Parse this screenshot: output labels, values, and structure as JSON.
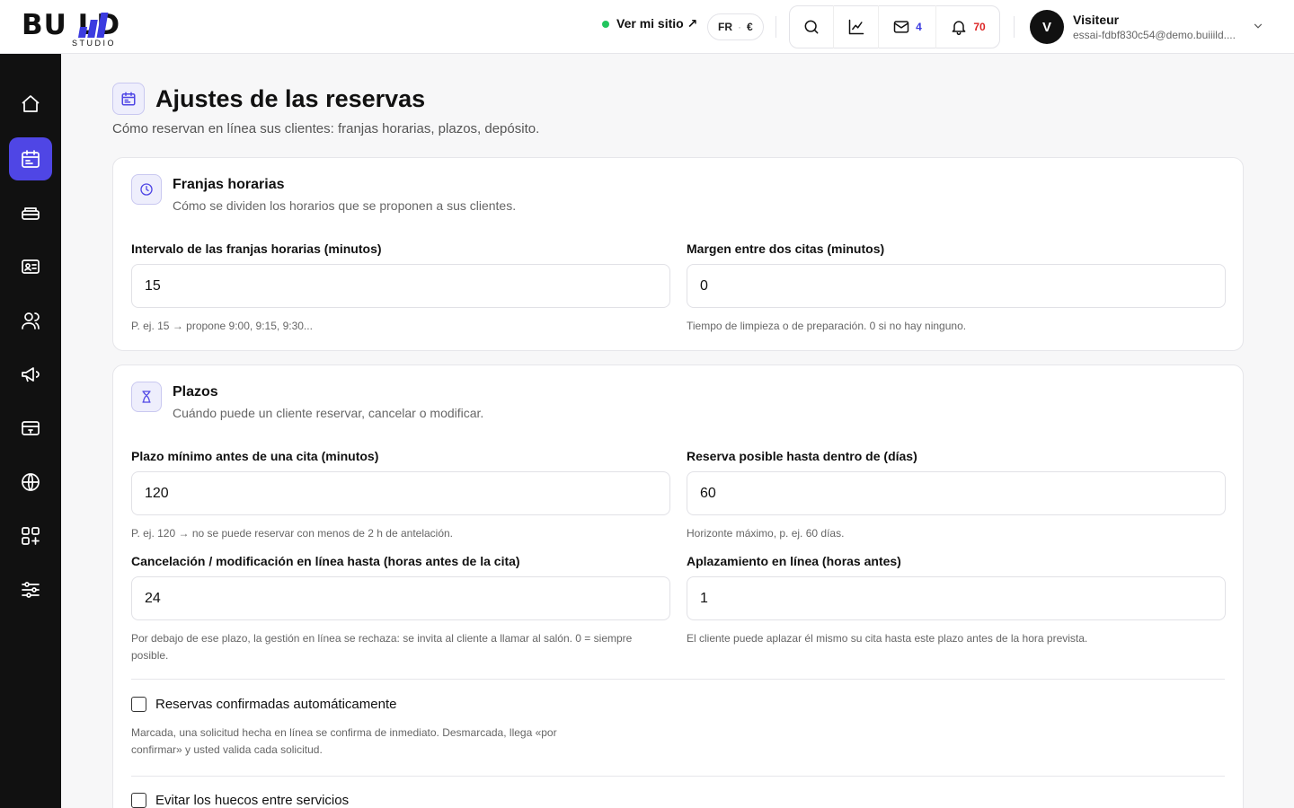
{
  "brand": {
    "logo_text": "BU  LD",
    "logo_sub": "STUDIO",
    "accent": "#4f46e5"
  },
  "header": {
    "site_link": "Ver mi sitio ↗",
    "lang": "FR",
    "currency": "€",
    "messages_count": "4",
    "notifications_count": "70",
    "user": {
      "initial": "V",
      "name": "Visiteur",
      "email": "essai-fdbf830c54@demo.buiiild...."
    }
  },
  "sidebar": {
    "items": [
      {
        "name": "home",
        "icon": "home-icon"
      },
      {
        "name": "calendar",
        "icon": "calendar-icon",
        "active": true
      },
      {
        "name": "services",
        "icon": "stack-icon"
      },
      {
        "name": "contacts",
        "icon": "id-card-icon"
      },
      {
        "name": "clients",
        "icon": "users-icon"
      },
      {
        "name": "marketing",
        "icon": "megaphone-icon"
      },
      {
        "name": "payments",
        "icon": "card-icon"
      },
      {
        "name": "website",
        "icon": "globe-icon"
      },
      {
        "name": "apps",
        "icon": "apps-add-icon"
      },
      {
        "name": "settings",
        "icon": "sliders-icon"
      }
    ]
  },
  "page": {
    "title": "Ajustes de las reservas",
    "subtitle": "Cómo reservan en línea sus clientes: franjas horarias, plazos, depósito."
  },
  "slots": {
    "title": "Franjas horarias",
    "desc": "Cómo se dividen los horarios que se proponen a sus clientes.",
    "interval_label": "Intervalo de las franjas horarias (minutos)",
    "interval_value": "15",
    "interval_hint": "P. ej. 15 → propone 9:00, 9:15, 9:30...",
    "margin_label": "Margen entre dos citas (minutos)",
    "margin_value": "0",
    "margin_hint": "Tiempo de limpieza o de preparación. 0 si no hay ninguno."
  },
  "deadlines": {
    "title": "Plazos",
    "desc": "Cuándo puede un cliente reservar, cancelar o modificar.",
    "min_label": "Plazo mínimo antes de una cita (minutos)",
    "min_value": "120",
    "min_hint": "P. ej. 120 → no se puede reservar con menos de 2 h de antelación.",
    "max_label": "Reserva posible hasta dentro de (días)",
    "max_value": "60",
    "max_hint": "Horizonte máximo, p. ej. 60 días.",
    "cancel_label": "Cancelación / modificación en línea hasta (horas antes de la cita)",
    "cancel_value": "24",
    "cancel_hint": "Por debajo de ese plazo, la gestión en línea se rechaza: se invita al cliente a llamar al salón. 0 = siempre posible.",
    "postpone_label": "Aplazamiento en línea (horas antes)",
    "postpone_value": "1",
    "postpone_hint": "El cliente puede aplazar él mismo su cita hasta este plazo antes de la hora prevista.",
    "auto_confirm_label": "Reservas confirmadas automáticamente",
    "auto_confirm_checked": false,
    "auto_confirm_hint": "Marcada, una solicitud hecha en línea se confirma de inmediato. Desmarcada, llega «por confirmar» y usted valida cada solicitud.",
    "gaps_label": "Evitar los huecos entre servicios",
    "gaps_checked": false
  }
}
